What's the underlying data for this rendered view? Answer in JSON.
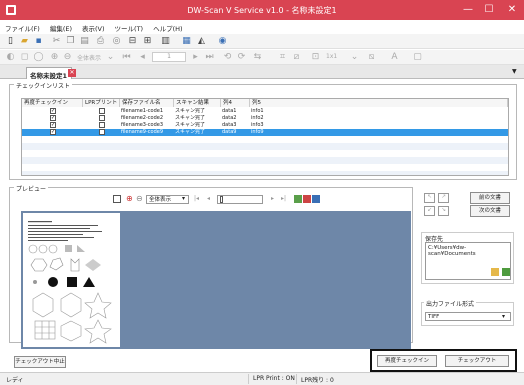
{
  "window": {
    "title": "DW-Scan V Service v1.0 - 名称未設定1",
    "minimize": "—",
    "maximize": "☐",
    "close": "✕"
  },
  "menu": [
    "ファイル(F)",
    "編集(E)",
    "表示(V)",
    "ツール(T)",
    "ヘルプ(H)"
  ],
  "toolbar2": {
    "zoom_label": "全体表示",
    "page_number": "1",
    "size_label": "1x1"
  },
  "tab": {
    "label": "名称未設定1",
    "close": "✕"
  },
  "checkin": {
    "group_label": "チェックインリスト",
    "columns": [
      "再度チェックイン",
      "LPRプリント",
      "保存ファイル名",
      "スキャン結果",
      "列4",
      "列5"
    ],
    "rows": [
      {
        "recheck": true,
        "lpr": false,
        "file": "filename1-code1",
        "result": "スキャン完了",
        "col4": "data1",
        "col5": "info1",
        "selected": false
      },
      {
        "recheck": true,
        "lpr": false,
        "file": "filename2-code2",
        "result": "スキャン完了",
        "col4": "data2",
        "col5": "info2",
        "selected": false
      },
      {
        "recheck": true,
        "lpr": false,
        "file": "filename3-code3",
        "result": "スキャン完了",
        "col4": "data3",
        "col5": "info3",
        "selected": false
      },
      {
        "recheck": true,
        "lpr": false,
        "file": "filename9-code9",
        "result": "スキャン完了",
        "col4": "data9",
        "col5": "info9",
        "selected": true
      }
    ]
  },
  "preview": {
    "group_label": "プレビュー",
    "zoom_label": "全体表示"
  },
  "side": {
    "prev_doc": "前の文書",
    "next_doc": "次の文書",
    "dest_label": "保存先",
    "dest_value": "C:¥Users¥dw-scan¥Documents",
    "format_label": "出力ファイル形式",
    "format_value": "TIFF"
  },
  "buttons": {
    "stop": "チェックアウト中止",
    "recheck": "再度チェックイン",
    "checkout": "チェックアウト"
  },
  "status": {
    "left": "レディ",
    "lpr": "LPR Print : ON",
    "remaining": "LPR残り : 0"
  }
}
